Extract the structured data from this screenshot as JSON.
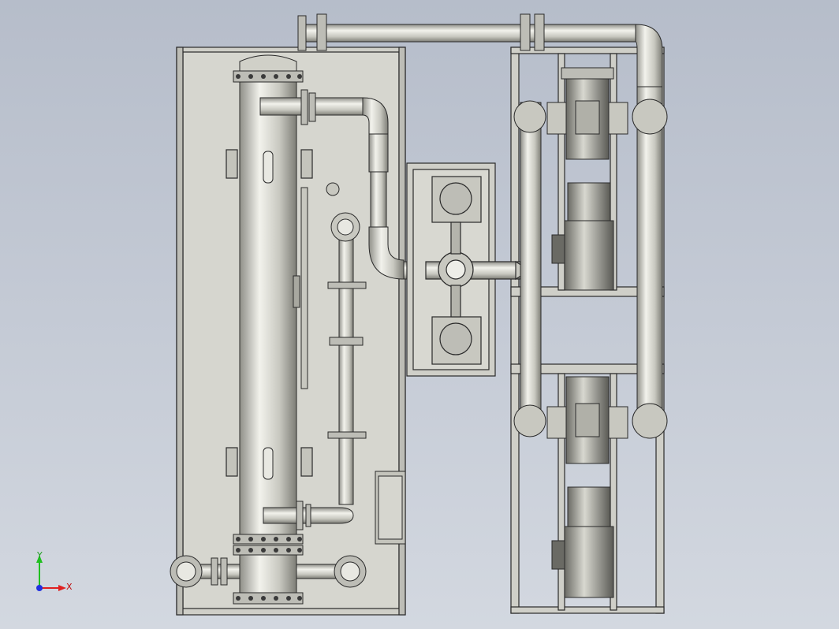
{
  "viewport": {
    "background_top": "#b6bdca",
    "background_bottom": "#d3d8e0"
  },
  "model": {
    "metal_color": "#c9c9c2",
    "edge_color": "#2a2a2a",
    "frame_color": "#cfcfc8"
  },
  "triad": {
    "x_label": "X",
    "y_label": "Y",
    "x_color": "#e02020",
    "y_color": "#20c020",
    "z_color": "#2030e0"
  }
}
